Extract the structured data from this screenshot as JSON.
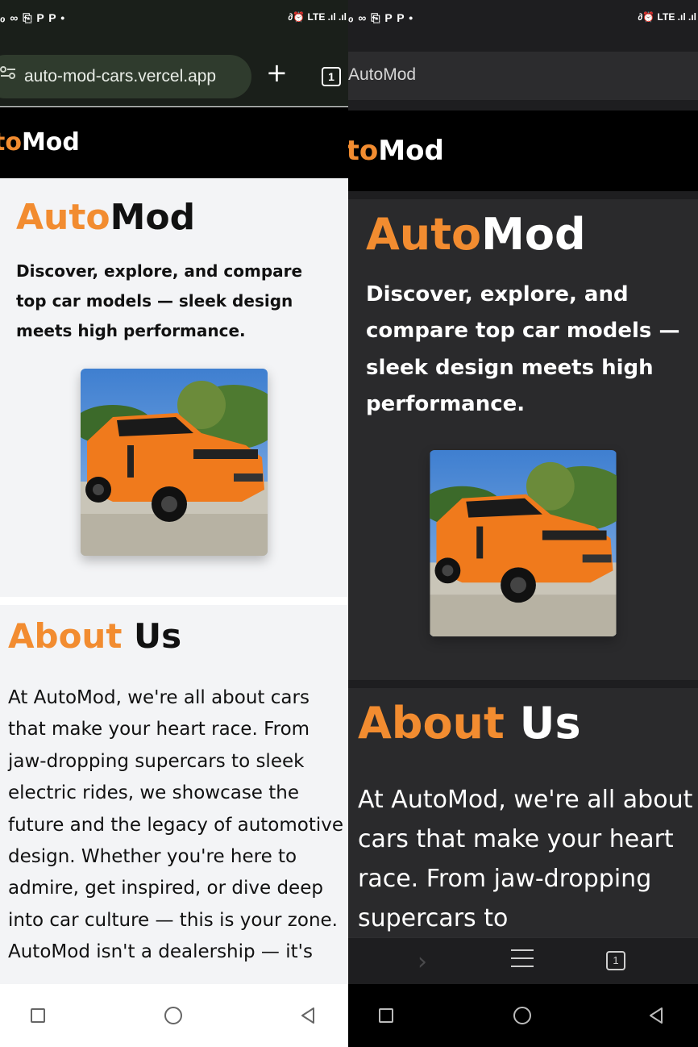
{
  "status_bar": {
    "left_icons": "ℴ ∞ ⎘ P P •",
    "right_icons": "∂⏰ LTE .ıl .ıl"
  },
  "left_screen": {
    "browser": {
      "url": "auto-mod-cars.vercel.app",
      "new_tab": "+",
      "tab_count": "1"
    },
    "site_logo": {
      "accent": "to",
      "rest": "Mod"
    },
    "hero": {
      "title_accent": "Auto",
      "title_rest": "Mod",
      "tagline": "Discover, explore, and compare top car models — sleek design meets high performance."
    },
    "about": {
      "heading_accent": "About",
      "heading_rest": "Us",
      "body": "At AutoMod, we're all about cars that make your heart race. From jaw-dropping supercars to sleek electric rides, we showcase the future and the legacy of automotive design. Whether you're here to admire, get inspired, or dive deep into car culture — this is your zone. AutoMod isn't a dealership — it's"
    }
  },
  "right_screen": {
    "browser": {
      "tab_title": "AutoMod",
      "tab_count": "1"
    },
    "site_logo": {
      "accent": "ito",
      "rest": "Mod"
    },
    "hero": {
      "title_accent": "Auto",
      "title_rest": "Mod",
      "tagline": "Discover, explore, and compare top car models — sleek design meets high performance."
    },
    "about": {
      "heading_accent": "About",
      "heading_rest": "Us",
      "body": "At AutoMod, we're all about cars that make your heart race. From jaw-dropping supercars to"
    },
    "toolbar": {
      "forward": "›",
      "tabs": "1"
    }
  },
  "colors": {
    "accent": "#f28c30",
    "light_bg": "#f3f4f6",
    "dark_bg": "#2a2a2c",
    "header_bg": "#000000",
    "car_orange": "#f07a1c"
  },
  "icons": [
    "tune-icon",
    "plus-icon",
    "tab-switcher-icon",
    "forward-icon",
    "menu-icon",
    "nav-recents-icon",
    "nav-home-icon",
    "nav-back-icon"
  ]
}
